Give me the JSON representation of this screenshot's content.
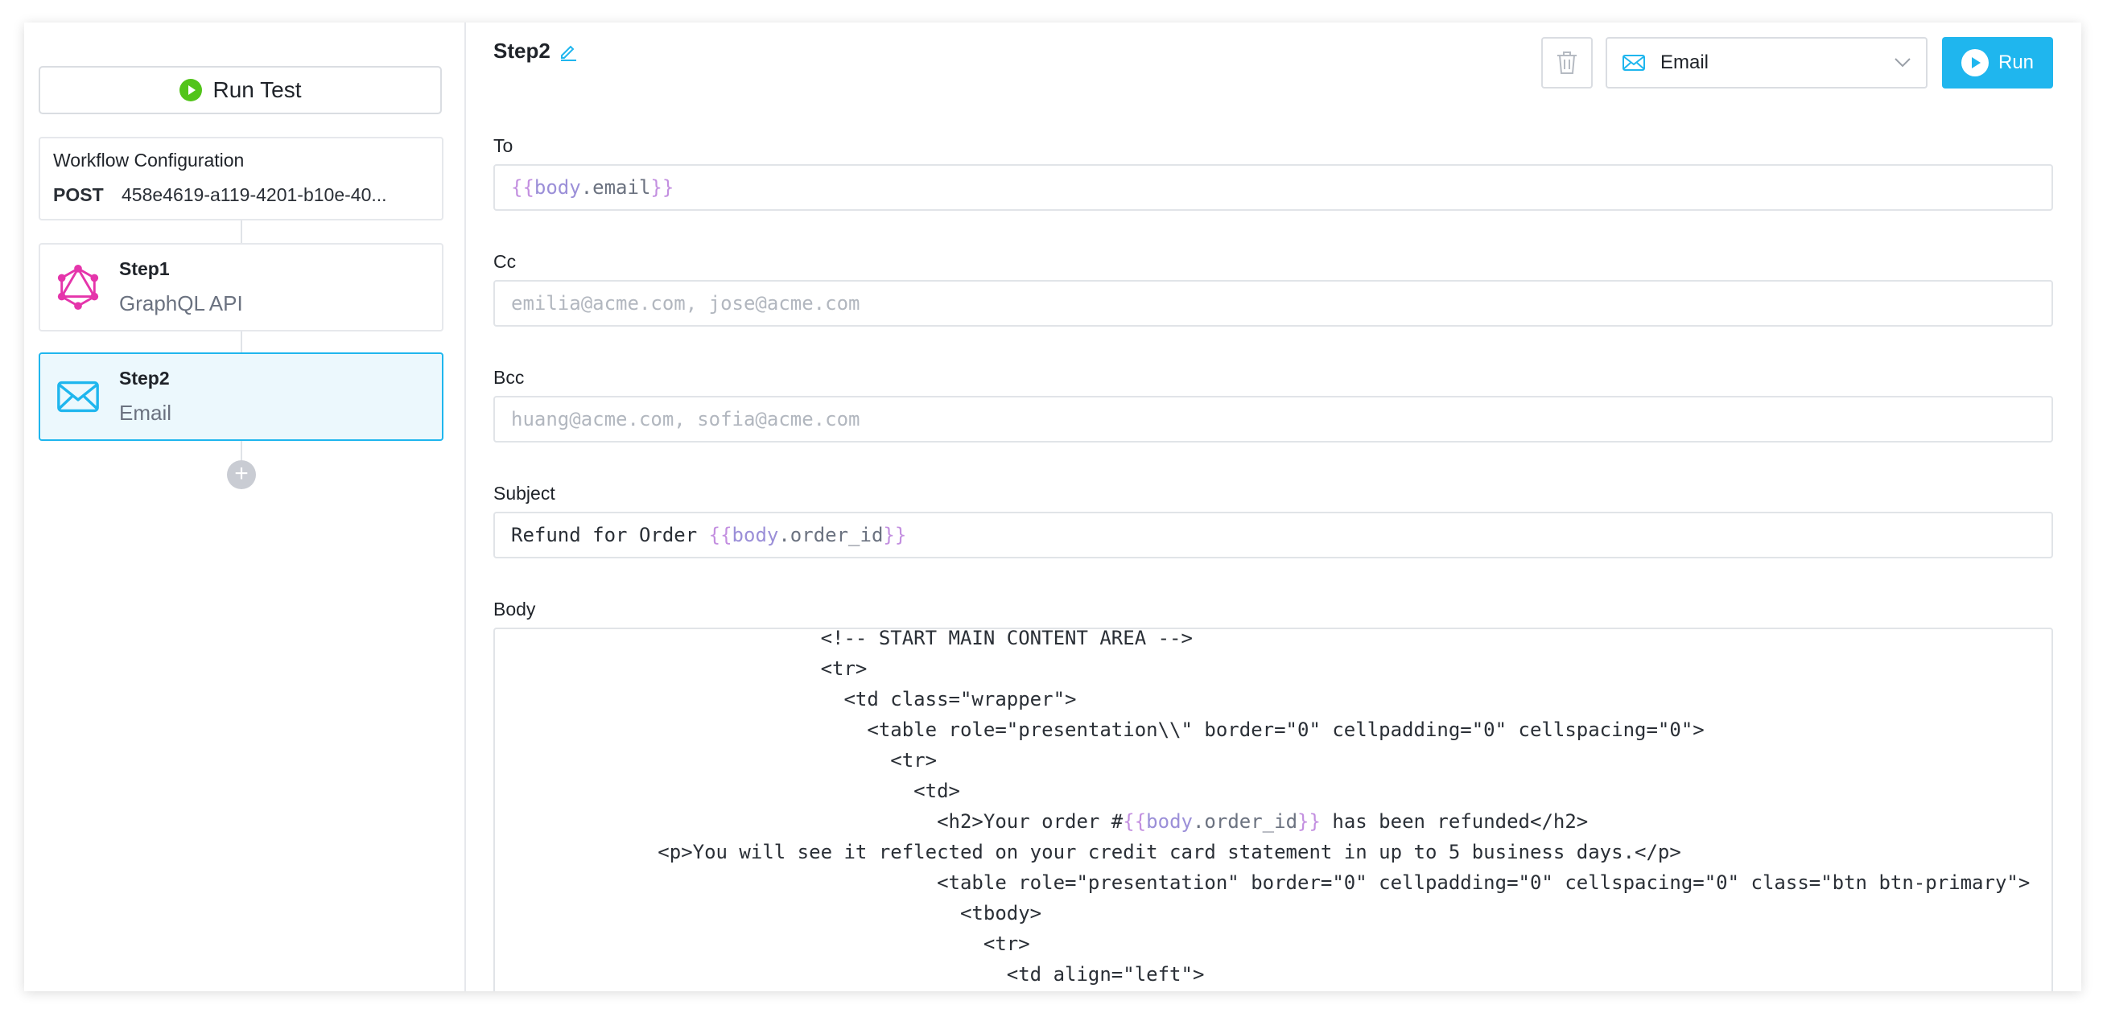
{
  "sidebar": {
    "run_test_label": "Run Test",
    "workflow": {
      "title": "Workflow Configuration",
      "method": "POST",
      "id": "458e4619-a119-4201-b10e-40..."
    },
    "steps": [
      {
        "name": "Step1",
        "type": "GraphQL API",
        "icon": "graphql-icon",
        "color": "#e535ab"
      },
      {
        "name": "Step2",
        "type": "Email",
        "icon": "envelope-icon",
        "color": "#1fb6ee",
        "active": true
      }
    ],
    "add_label": "+"
  },
  "header": {
    "step_title": "Step2",
    "step_type_select": "Email",
    "run_label": "Run"
  },
  "fields": {
    "to": {
      "label": "To",
      "value": "{{body.email}}"
    },
    "cc": {
      "label": "Cc",
      "placeholder": "emilia@acme.com, jose@acme.com"
    },
    "bcc": {
      "label": "Bcc",
      "placeholder": "huang@acme.com, sofia@acme.com"
    },
    "subject": {
      "label": "Subject",
      "value": "Refund for Order {{body.order_id}}"
    },
    "body": {
      "label": "Body",
      "lines": [
        "                            <!-- START MAIN CONTENT AREA -->",
        "                            <tr>",
        "                              <td class=\"wrapper\">",
        "                                <table role=\"presentation\\\\\" border=\"0\" cellpadding=\"0\" cellspacing=\"0\">",
        "                                  <tr>",
        "                                    <td>",
        "                                      <h2>Your order #{{body.order_id}} has been refunded</h2>",
        "              <p>You will see it reflected on your credit card statement in up to 5 business days.</p>",
        "                                      <table role=\"presentation\" border=\"0\" cellpadding=\"0\" cellspacing=\"0\" class=\"btn btn-primary\">",
        "                                        <tbody>",
        "                                          <tr>",
        "                                            <td align=\"left\">"
      ]
    }
  },
  "colors": {
    "accent": "#1fb6ee",
    "success": "#52c41a",
    "graphql": "#e535ab",
    "template_var": "#9b8fd8"
  }
}
